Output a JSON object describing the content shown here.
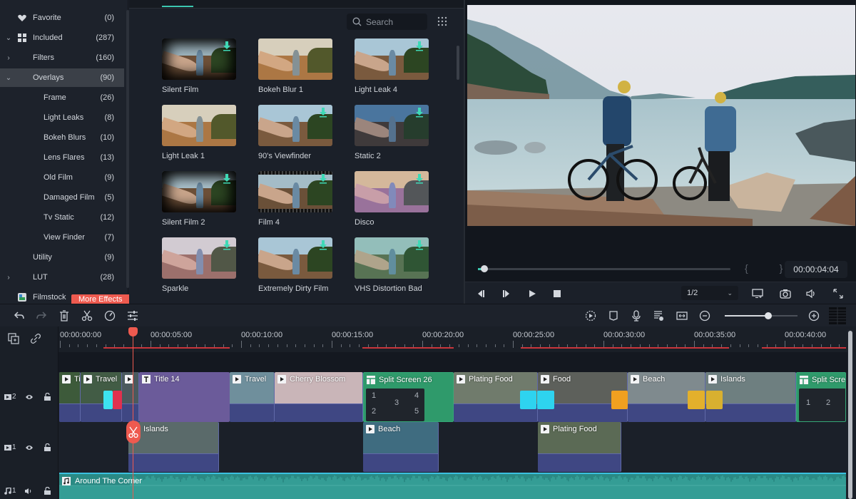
{
  "sidebar": {
    "items": [
      {
        "label": "Favorite",
        "count": "(0)",
        "icon": "heart-icon",
        "chevron": "",
        "level": 0
      },
      {
        "label": "Included",
        "count": "(287)",
        "icon": "grid-icon",
        "chevron": "⌄",
        "level": 0
      },
      {
        "label": "Filters",
        "count": "(160)",
        "icon": "",
        "chevron": "›",
        "level": 0
      },
      {
        "label": "Overlays",
        "count": "(90)",
        "icon": "",
        "chevron": "⌄",
        "level": 0,
        "active": true
      },
      {
        "label": "Frame",
        "count": "(26)",
        "level": 1
      },
      {
        "label": "Light Leaks",
        "count": "(8)",
        "level": 1
      },
      {
        "label": "Bokeh Blurs",
        "count": "(10)",
        "level": 1
      },
      {
        "label": "Lens Flares",
        "count": "(13)",
        "level": 1
      },
      {
        "label": "Old Film",
        "count": "(9)",
        "level": 1
      },
      {
        "label": "Damaged Film",
        "count": "(5)",
        "level": 1
      },
      {
        "label": "Tv Static",
        "count": "(12)",
        "level": 1
      },
      {
        "label": "View Finder",
        "count": "(7)",
        "level": 1
      },
      {
        "label": "Utility",
        "count": "(9)",
        "level": 0
      },
      {
        "label": "LUT",
        "count": "(28)",
        "chevron": "›",
        "level": 0
      },
      {
        "label": "Filmstock",
        "count": "",
        "icon": "filmstock-icon",
        "level": 0
      }
    ],
    "more_effects_label": "More Effects",
    "collapse_icon": "◂"
  },
  "library": {
    "search_placeholder": "Search",
    "items": [
      {
        "label": "Silent Film",
        "download": true,
        "style": "vignette"
      },
      {
        "label": "Bokeh Blur 1",
        "download": false,
        "style": "warm"
      },
      {
        "label": "Light Leak 4",
        "download": true,
        "style": "normal"
      },
      {
        "label": "Light Leak 1",
        "download": false,
        "style": "warm"
      },
      {
        "label": "90's Viewfinder",
        "download": true,
        "style": "normal"
      },
      {
        "label": "Static 2",
        "download": true,
        "style": "blue"
      },
      {
        "label": "Silent Film 2",
        "download": true,
        "style": "vignette2"
      },
      {
        "label": "Film 4",
        "download": true,
        "style": "film"
      },
      {
        "label": "Disco",
        "download": true,
        "style": "disco"
      },
      {
        "label": "Sparkle",
        "download": true,
        "style": "sparkle"
      },
      {
        "label": "Extremely Dirty Film",
        "download": true,
        "style": "normal"
      },
      {
        "label": "VHS Distortion Bad",
        "download": true,
        "style": "green"
      }
    ]
  },
  "preview": {
    "timecode": "00:00:04:04",
    "in_out_marks": "{ }",
    "progress": 0.01,
    "quality": "1/2",
    "controls": [
      "prev-frame",
      "next-frame",
      "play",
      "stop"
    ],
    "right_controls": [
      "display-settings",
      "snapshot",
      "volume",
      "fullscreen"
    ]
  },
  "toolbar": {
    "left": [
      "undo",
      "redo",
      "delete",
      "cut",
      "speed",
      "adjust"
    ],
    "right": [
      "render-preview",
      "marker",
      "voiceover",
      "audio-mixer",
      "fit",
      "zoom-out",
      "zoom-in",
      "layout"
    ],
    "zoom_level": 0.6
  },
  "timeline": {
    "ruler_labels": [
      "00:00:00:00",
      "00:00:05:00",
      "00:00:10:00",
      "00:00:15:00",
      "00:00:20:00",
      "00:00:25:00",
      "00:00:30:00",
      "00:00:35:00",
      "00:00:40:00"
    ],
    "playhead_time": "00:00:04:04",
    "tracks": [
      {
        "name": "video-2",
        "label": "2",
        "type": "video"
      },
      {
        "name": "video-1",
        "label": "1",
        "type": "video"
      },
      {
        "name": "audio-1",
        "label": "1",
        "type": "audio"
      }
    ],
    "track2_clips": [
      {
        "title": "Ti",
        "kind": "video"
      },
      {
        "title": "Travel",
        "kind": "video"
      },
      {
        "title": "",
        "kind": "video"
      },
      {
        "title": "Title 14",
        "kind": "title"
      },
      {
        "title": "Travel",
        "kind": "video"
      },
      {
        "title": "Cherry Blossom",
        "kind": "video"
      },
      {
        "title": "Split Screen 26",
        "kind": "split",
        "cells": [
          "1",
          "2",
          "3",
          "4",
          "5"
        ]
      },
      {
        "title": "Plating Food",
        "kind": "video"
      },
      {
        "title": "Food",
        "kind": "video"
      },
      {
        "title": "Beach",
        "kind": "video"
      },
      {
        "title": "Islands",
        "kind": "video"
      },
      {
        "title": "Split Scre",
        "kind": "split",
        "cells": [
          "1",
          "2"
        ]
      }
    ],
    "track1_clips": [
      {
        "title": "Islands"
      },
      {
        "title": "Beach"
      },
      {
        "title": "Plating Food"
      }
    ],
    "audio_clip": {
      "title": "Around The Corner"
    }
  },
  "colors": {
    "accent": "#3cc7b0",
    "playhead": "#ee5a4f",
    "title_clip": "#6b5b9a",
    "split_clip": "#2f9a6b",
    "video_band": "#3f4783",
    "audio_clip": "#2a8a84"
  }
}
